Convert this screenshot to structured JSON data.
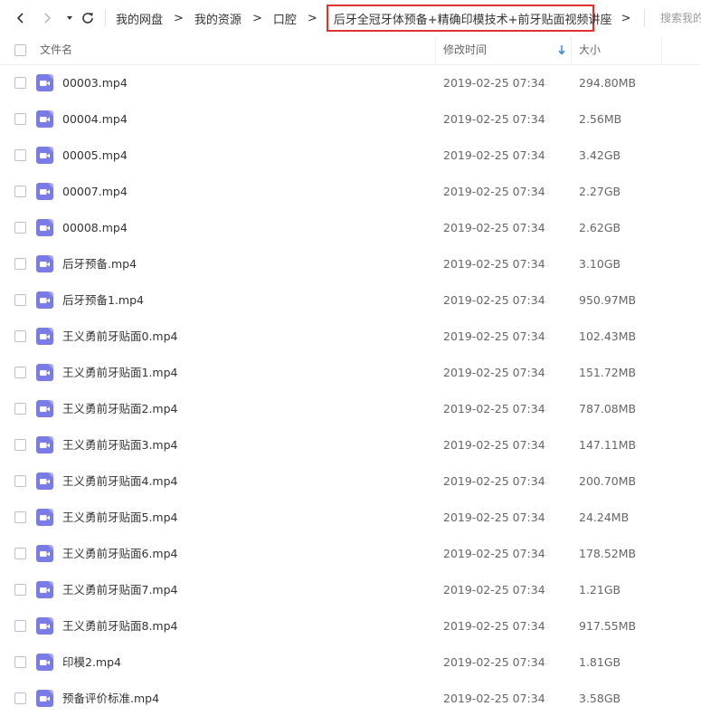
{
  "nav": {
    "breadcrumb": [
      "我的网盘",
      "我的资源",
      "口腔"
    ],
    "current_folder": "后牙全冠牙体预备+精确印模技术+前牙贴面视频讲座",
    "separator": ">",
    "search_placeholder": "搜索我的"
  },
  "columns": {
    "name": "文件名",
    "modified": "修改时间",
    "size": "大小"
  },
  "colors": {
    "highlight_border": "#e0312b",
    "video_icon": "#7b7be6",
    "sort_arrow": "#2c84e8"
  },
  "files": [
    {
      "name": "00003.mp4",
      "modified": "2019-02-25 07:34",
      "size": "294.80MB"
    },
    {
      "name": "00004.mp4",
      "modified": "2019-02-25 07:34",
      "size": "2.56MB"
    },
    {
      "name": "00005.mp4",
      "modified": "2019-02-25 07:34",
      "size": "3.42GB"
    },
    {
      "name": "00007.mp4",
      "modified": "2019-02-25 07:34",
      "size": "2.27GB"
    },
    {
      "name": "00008.mp4",
      "modified": "2019-02-25 07:34",
      "size": "2.62GB"
    },
    {
      "name": "后牙预备.mp4",
      "modified": "2019-02-25 07:34",
      "size": "3.10GB"
    },
    {
      "name": "后牙预备1.mp4",
      "modified": "2019-02-25 07:34",
      "size": "950.97MB"
    },
    {
      "name": "王义勇前牙贴面0.mp4",
      "modified": "2019-02-25 07:34",
      "size": "102.43MB"
    },
    {
      "name": "王义勇前牙贴面1.mp4",
      "modified": "2019-02-25 07:34",
      "size": "151.72MB"
    },
    {
      "name": "王义勇前牙贴面2.mp4",
      "modified": "2019-02-25 07:34",
      "size": "787.08MB"
    },
    {
      "name": "王义勇前牙贴面3.mp4",
      "modified": "2019-02-25 07:34",
      "size": "147.11MB"
    },
    {
      "name": "王义勇前牙贴面4.mp4",
      "modified": "2019-02-25 07:34",
      "size": "200.70MB"
    },
    {
      "name": "王义勇前牙贴面5.mp4",
      "modified": "2019-02-25 07:34",
      "size": "24.24MB"
    },
    {
      "name": "王义勇前牙贴面6.mp4",
      "modified": "2019-02-25 07:34",
      "size": "178.52MB"
    },
    {
      "name": "王义勇前牙贴面7.mp4",
      "modified": "2019-02-25 07:34",
      "size": "1.21GB"
    },
    {
      "name": "王义勇前牙贴面8.mp4",
      "modified": "2019-02-25 07:34",
      "size": "917.55MB"
    },
    {
      "name": "印模2.mp4",
      "modified": "2019-02-25 07:34",
      "size": "1.81GB"
    },
    {
      "name": "预备评价标准.mp4",
      "modified": "2019-02-25 07:34",
      "size": "3.58GB"
    }
  ]
}
